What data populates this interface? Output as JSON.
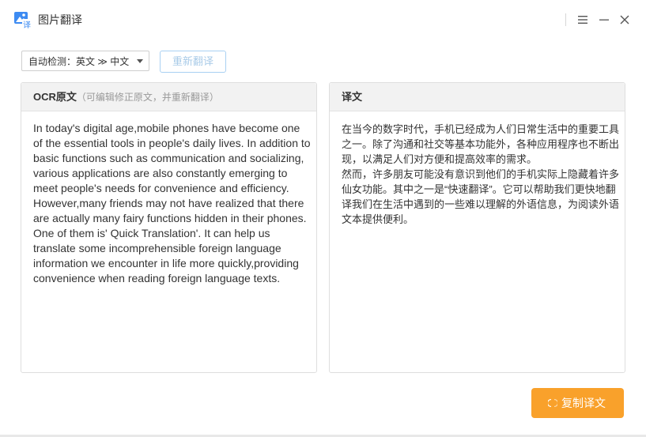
{
  "app": {
    "title": "图片翻译",
    "icon": "image-translate-app-icon",
    "window_controls": [
      "menu-icon",
      "minimize-icon",
      "close-icon"
    ]
  },
  "toolbar": {
    "language_select": "自动检测：英文 ≫ 中文",
    "retranslate_label": "重新翻译"
  },
  "source_panel": {
    "title": "OCR原文",
    "hint": "（可编辑修正原文，并重新翻译）",
    "text": "In today's digital age,mobile phones have become one of the essential tools in people's daily lives. In addition to basic functions such as communication and socializing, various applications are also constantly emerging to meet people's needs for convenience and efficiency.\nHowever,many friends may not have realized that there are actually many fairy functions hidden in their phones. One of them is' Quick Translation'. It can help us translate some incomprehensible foreign language information we encounter in life more quickly,providing convenience when reading foreign language texts."
  },
  "target_panel": {
    "title": "译文",
    "text": "在当今的数字时代，手机已经成为人们日常生活中的重要工具之一。除了沟通和社交等基本功能外，各种应用程序也不断出现，以满足人们对方便和提高效率的需求。\n然而，许多朋友可能没有意识到他们的手机实际上隐藏着许多仙女功能。其中之一是“快速翻译”。它可以帮助我们更快地翻译我们在生活中遇到的一些难以理解的外语信息，为阅读外语文本提供便利。"
  },
  "actions": {
    "copy_label": "复制译文",
    "copy_icon": "copy-icon"
  },
  "colors": {
    "accent_orange": "#f9a12b",
    "disabled_blue": "#a9cbe8",
    "app_icon_blue": "#3d8bf2"
  }
}
